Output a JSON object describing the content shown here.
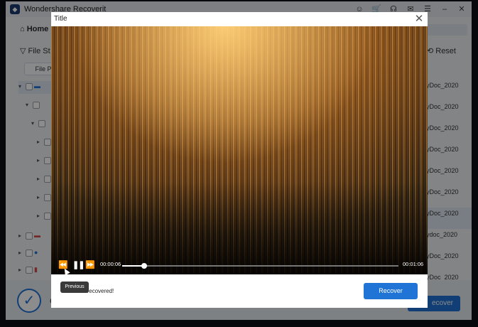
{
  "app": {
    "title": "Wondershare Recoverit",
    "home_label": "Home",
    "filter_label": "File St",
    "reset_label": "Reset",
    "path_button": "File P",
    "bottom_letter": "C",
    "recover_button": "ecover"
  },
  "file_list": [
    "yDoc_2020",
    "yDoc_2020",
    "yDoc_2020",
    "yDoc_2020",
    "yDoc_2020",
    "yDoc_2020",
    "yDoc_2020",
    "ydoc_2020",
    "yDoc_2020",
    "yDoc_2020"
  ],
  "modal": {
    "title": "Title",
    "close_glyph": "✕",
    "current_time": "00:00:06",
    "duration": "00:01:06",
    "progress_fraction": 0.08,
    "info_text": "les to be recovered!",
    "recover_button": "Recover",
    "tooltip": "Previous"
  },
  "icons": {
    "rewind": "⏪",
    "pause": "❚❚",
    "forward": "⏩",
    "accent": "#1f74d6"
  }
}
